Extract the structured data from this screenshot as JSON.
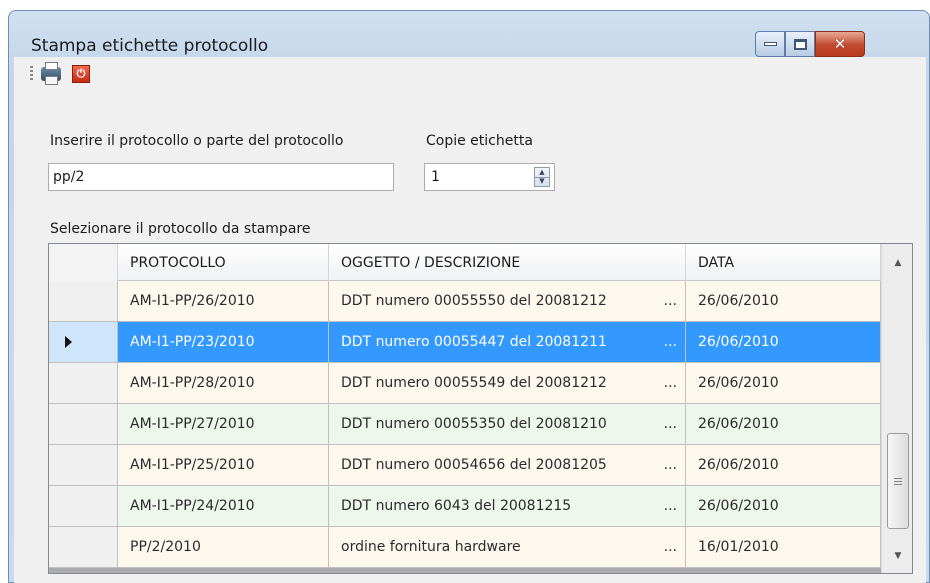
{
  "window": {
    "title": "Stampa etichette protocollo",
    "controls": {
      "minimize": "minimize",
      "maximize": "maximize",
      "close": "✕"
    }
  },
  "toolbar": {
    "items": [
      {
        "icon": "printer-icon"
      },
      {
        "icon": "power-stop-icon",
        "glyph": "⏻",
        "color": "#d9391e"
      }
    ]
  },
  "form": {
    "protocol_label": "Inserire il protocollo o parte del protocollo",
    "protocol_value": "pp/2",
    "copies_label": "Copie etichetta",
    "copies_value": "1",
    "grid_label": "Selezionare il protocollo da stampare"
  },
  "grid": {
    "columns": [
      "PROTOCOLLO",
      "OGGETTO / DESCRIZIONE",
      "DATA"
    ],
    "selected_row_index": 1,
    "rows": [
      {
        "protocollo": "AM-I1-PP/26/2010",
        "descrizione": "DDT numero 00055550 del 20081212",
        "data": "26/06/2010"
      },
      {
        "protocollo": "AM-I1-PP/23/2010",
        "descrizione": "DDT numero 00055447 del 20081211",
        "data": "26/06/2010"
      },
      {
        "protocollo": "AM-I1-PP/28/2010",
        "descrizione": "DDT numero 00055549 del 20081212",
        "data": "26/06/2010"
      },
      {
        "protocollo": "AM-I1-PP/27/2010",
        "descrizione": "DDT numero 00055350 del 20081210",
        "data": "26/06/2010"
      },
      {
        "protocollo": "AM-I1-PP/25/2010",
        "descrizione": "DDT numero 00054656 del 20081205",
        "data": "26/06/2010"
      },
      {
        "protocollo": "AM-I1-PP/24/2010",
        "descrizione": "DDT numero 6043 del 20081215",
        "data": "26/06/2010"
      },
      {
        "protocollo": "PP/2/2010",
        "descrizione": "ordine fornitura hardware",
        "data": "16/01/2010"
      }
    ],
    "ellipsis": "...",
    "colors": {
      "selected": "#3399ff",
      "row_odd": "#fdf8ee",
      "row_even": "#eef7ec"
    }
  }
}
